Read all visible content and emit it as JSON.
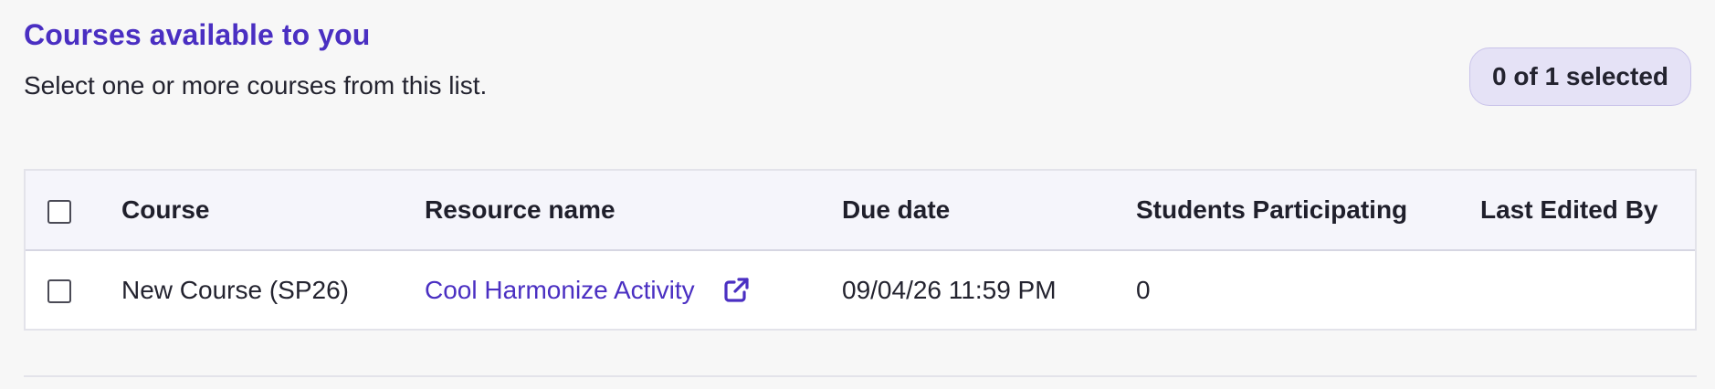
{
  "header": {
    "title": "Courses available to you",
    "subtitle": "Select one or more courses from this list.",
    "selection_status": "0 of 1 selected"
  },
  "table": {
    "columns": [
      "Course",
      "Resource name",
      "Due date",
      "Students Participating",
      "Last Edited By"
    ],
    "rows": [
      {
        "checked": false,
        "course": "New Course (SP26)",
        "resource_name": "Cool Harmonize Activity",
        "resource_icon": "external-link-icon",
        "due_date": "09/04/26 11:59 PM",
        "students_participating": "0",
        "last_edited_by": ""
      }
    ]
  },
  "colors": {
    "accent": "#4a2fc2",
    "badge_bg": "#e5e2f6",
    "header_row_bg": "#f5f5fb",
    "page_bg": "#f7f7f7"
  }
}
